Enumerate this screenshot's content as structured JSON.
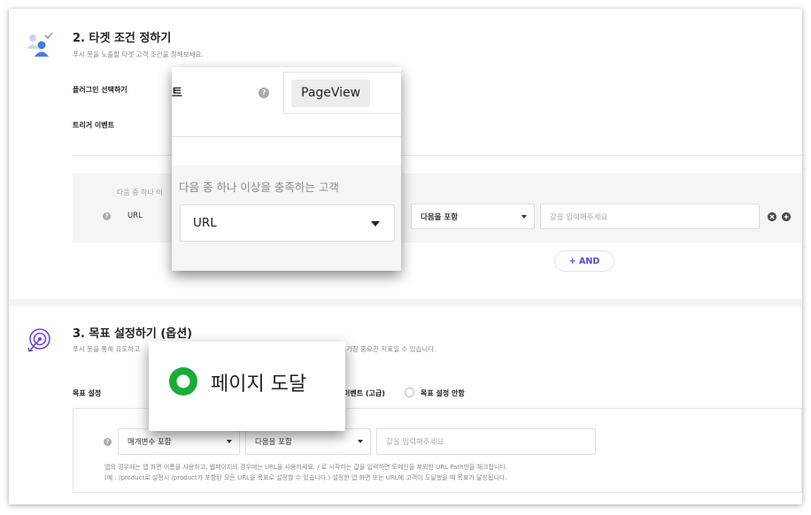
{
  "section_target": {
    "title": "2. 타겟 조건 정하기",
    "description": "푸시 봇을 노출할 타겟 고객 조건을 정해보세요.",
    "plugin_label": "플러그인 선택하기",
    "trigger_label": "트리거 이벤트",
    "condition_header": "다음 중 하나 이",
    "row_help": "?",
    "attribute_value": "URL",
    "operator_value": "다음을 포함",
    "value_placeholder": "값을 입력해주세요",
    "remove_icon": "x-circle-icon",
    "add_icon": "plus-circle-icon",
    "and_label": "+ AND"
  },
  "section_goal": {
    "title": "3. 목표 설정하기 (옵션)",
    "description": "푸시 봇을 통해 유도하고",
    "description_tail": "가장 중요한 지표일 수 있습니다.",
    "goal_label": "목표 설정",
    "option_event": "이벤트 (고급)",
    "option_none": "목표 설정 안함",
    "row_help": "?",
    "param_value": "매개변수 포함",
    "operator_value": "다음을 포함",
    "value_placeholder": "값을 입력해주세요",
    "hint_line1": "앱의 경우에는 앱 화면 이름을 사용하고, 웹페이지의 경우에는 URL을 사용하세요. / 로 시작하는 값을 입력하면 도메인을 제외한 URL Path만을 체크합니다.",
    "hint_line2": "(예 : /product로 설정시 /product가 포함된 모든 URL을 목표로 설정할 수 있습니다.) 설정한 앱 화면 또는 URL에 고객이 도달했을 때 목표가 달성됩니다."
  },
  "zoom_trigger": {
    "label_fragment": "트",
    "help": "?",
    "trigger_value": "PageView",
    "condition_title": "다음 중 하나 이상을 충족하는 고객",
    "attribute_value": "URL"
  },
  "zoom_goal": {
    "selected_option": "페이지 도달"
  },
  "colors": {
    "accent_purple": "#5b3de6",
    "radio_green": "#1aac3a",
    "icon_blue": "#3d7fe0"
  }
}
